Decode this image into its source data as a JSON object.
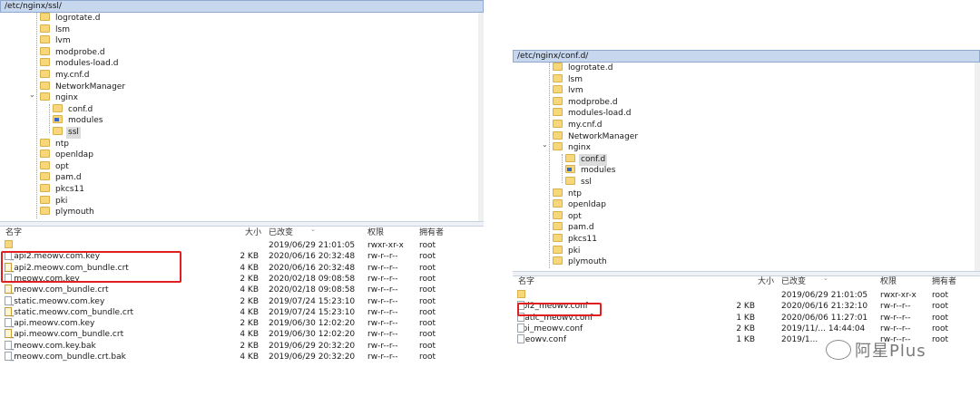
{
  "left": {
    "path": "/etc/nginx/ssl/",
    "tree": [
      {
        "label": "logrotate.d",
        "depth": 0
      },
      {
        "label": "lsm",
        "depth": 0
      },
      {
        "label": "lvm",
        "depth": 0
      },
      {
        "label": "modprobe.d",
        "depth": 0
      },
      {
        "label": "modules-load.d",
        "depth": 0
      },
      {
        "label": "my.cnf.d",
        "depth": 0
      },
      {
        "label": "NetworkManager",
        "depth": 0
      },
      {
        "label": "nginx",
        "depth": 0,
        "expanded": true
      },
      {
        "label": "conf.d",
        "depth": 1
      },
      {
        "label": "modules",
        "depth": 1,
        "link": true
      },
      {
        "label": "ssl",
        "depth": 1,
        "selected": true
      },
      {
        "label": "ntp",
        "depth": 0
      },
      {
        "label": "openldap",
        "depth": 0
      },
      {
        "label": "opt",
        "depth": 0
      },
      {
        "label": "pam.d",
        "depth": 0
      },
      {
        "label": "pkcs11",
        "depth": 0
      },
      {
        "label": "pki",
        "depth": 0
      },
      {
        "label": "plymouth",
        "depth": 0
      }
    ],
    "columns": {
      "name": "名字",
      "size": "大小",
      "modified": "已改变",
      "perm": "权限",
      "owner": "拥有者"
    },
    "files": [
      {
        "name": "..",
        "size": "",
        "modified": "2019/06/29 21:01:05",
        "perm": "rwxr-xr-x",
        "owner": "root",
        "icon": "up"
      },
      {
        "name": "2_api2.meowv.com.key",
        "size": "2 KB",
        "modified": "2020/06/16 20:32:48",
        "perm": "rw-r--r--",
        "owner": "root",
        "icon": "file"
      },
      {
        "name": "1_api2.meowv.com_bundle.crt",
        "size": "4 KB",
        "modified": "2020/06/16 20:32:48",
        "perm": "rw-r--r--",
        "owner": "root",
        "icon": "cert"
      },
      {
        "name": "2_meowv.com.key",
        "size": "2 KB",
        "modified": "2020/02/18 09:08:58",
        "perm": "rw-r--r--",
        "owner": "root",
        "icon": "file"
      },
      {
        "name": "1_meowv.com_bundle.crt",
        "size": "4 KB",
        "modified": "2020/02/18 09:08:58",
        "perm": "rw-r--r--",
        "owner": "root",
        "icon": "cert"
      },
      {
        "name": "2_static.meowv.com.key",
        "size": "2 KB",
        "modified": "2019/07/24 15:23:10",
        "perm": "rw-r--r--",
        "owner": "root",
        "icon": "file"
      },
      {
        "name": "1_static.meowv.com_bundle.crt",
        "size": "4 KB",
        "modified": "2019/07/24 15:23:10",
        "perm": "rw-r--r--",
        "owner": "root",
        "icon": "cert"
      },
      {
        "name": "2_api.meowv.com.key",
        "size": "2 KB",
        "modified": "2019/06/30 12:02:20",
        "perm": "rw-r--r--",
        "owner": "root",
        "icon": "file"
      },
      {
        "name": "1_api.meowv.com_bundle.crt",
        "size": "4 KB",
        "modified": "2019/06/30 12:02:20",
        "perm": "rw-r--r--",
        "owner": "root",
        "icon": "cert"
      },
      {
        "name": "2_meowv.com.key.bak",
        "size": "2 KB",
        "modified": "2019/06/29 20:32:20",
        "perm": "rw-r--r--",
        "owner": "root",
        "icon": "file"
      },
      {
        "name": "1_meowv.com_bundle.crt.bak",
        "size": "4 KB",
        "modified": "2019/06/29 20:32:20",
        "perm": "rw-r--r--",
        "owner": "root",
        "icon": "file"
      }
    ]
  },
  "right": {
    "path": "/etc/nginx/conf.d/",
    "tree": [
      {
        "label": "logrotate.d",
        "depth": 0
      },
      {
        "label": "lsm",
        "depth": 0
      },
      {
        "label": "lvm",
        "depth": 0
      },
      {
        "label": "modprobe.d",
        "depth": 0
      },
      {
        "label": "modules-load.d",
        "depth": 0
      },
      {
        "label": "my.cnf.d",
        "depth": 0
      },
      {
        "label": "NetworkManager",
        "depth": 0
      },
      {
        "label": "nginx",
        "depth": 0,
        "expanded": true
      },
      {
        "label": "conf.d",
        "depth": 1,
        "selected": true
      },
      {
        "label": "modules",
        "depth": 1,
        "link": true
      },
      {
        "label": "ssl",
        "depth": 1
      },
      {
        "label": "ntp",
        "depth": 0
      },
      {
        "label": "openldap",
        "depth": 0
      },
      {
        "label": "opt",
        "depth": 0
      },
      {
        "label": "pam.d",
        "depth": 0
      },
      {
        "label": "pkcs11",
        "depth": 0
      },
      {
        "label": "pki",
        "depth": 0
      },
      {
        "label": "plymouth",
        "depth": 0
      }
    ],
    "columns": {
      "name": "名字",
      "size": "大小",
      "modified": "已改变",
      "perm": "权限",
      "owner": "拥有者"
    },
    "files": [
      {
        "name": "..",
        "size": "",
        "modified": "2019/06/29 21:01:05",
        "perm": "rwxr-xr-x",
        "owner": "root",
        "icon": "up"
      },
      {
        "name": "api2_meowv.conf",
        "size": "2 KB",
        "modified": "2020/06/16 21:32:10",
        "perm": "rw-r--r--",
        "owner": "root",
        "icon": "file"
      },
      {
        "name": "static_meowv.conf",
        "size": "1 KB",
        "modified": "2020/06/06 11:27:01",
        "perm": "rw-r--r--",
        "owner": "root",
        "icon": "file"
      },
      {
        "name": "api_meowv.conf",
        "size": "2 KB",
        "modified": "2019/11/... 14:44:04",
        "perm": "rw-r--r--",
        "owner": "root",
        "icon": "file"
      },
      {
        "name": "meowv.conf",
        "size": "1 KB",
        "modified": "2019/1...",
        "perm": "rw-r--r--",
        "owner": "root",
        "icon": "file"
      }
    ]
  },
  "watermark": {
    "text": "阿星Plus"
  },
  "colors": {
    "pathbar": "#c7d7ee",
    "highlight": "#e02020",
    "folder": "#f6d77a"
  }
}
